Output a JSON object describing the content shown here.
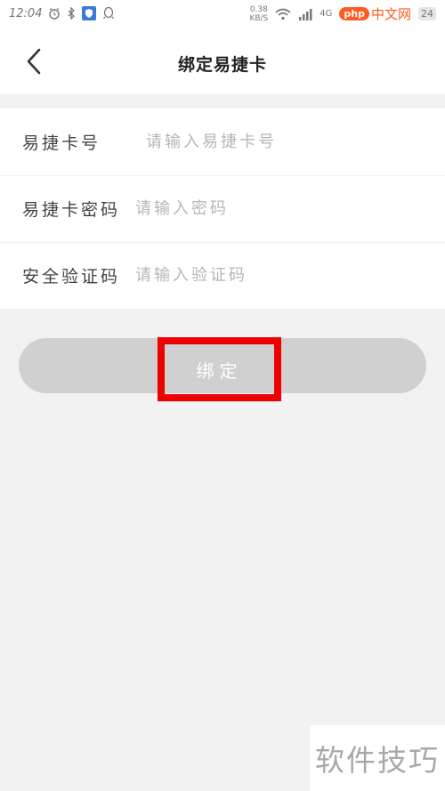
{
  "status_bar": {
    "time": "12:04",
    "speed_value": "0.38",
    "speed_unit": "KB/S",
    "network": "4G",
    "battery": "24",
    "brand_badge": "php",
    "brand_text": "中文网",
    "icons": [
      "alarm-icon",
      "bluetooth-icon",
      "shield-icon",
      "qq-icon",
      "wifi-icon",
      "signal-icon",
      "battery-icon"
    ]
  },
  "header": {
    "title": "绑定易捷卡",
    "back_icon": "chevron-left-icon"
  },
  "form": {
    "card_number": {
      "label": "易捷卡号",
      "placeholder": "请输入易捷卡号",
      "value": ""
    },
    "card_password": {
      "label": "易捷卡密码",
      "placeholder": "请输入密码",
      "value": ""
    },
    "security_code": {
      "label": "安全验证码",
      "placeholder": "请输入验证码",
      "value": ""
    }
  },
  "bind_button": {
    "label": "绑定",
    "highlight_color": "#ee0000"
  },
  "watermark": {
    "text": "软件技巧"
  },
  "colors": {
    "background": "#f2f2f2",
    "button_disabled": "#d0d0d0",
    "brand_orange": "#ff5a1f"
  }
}
